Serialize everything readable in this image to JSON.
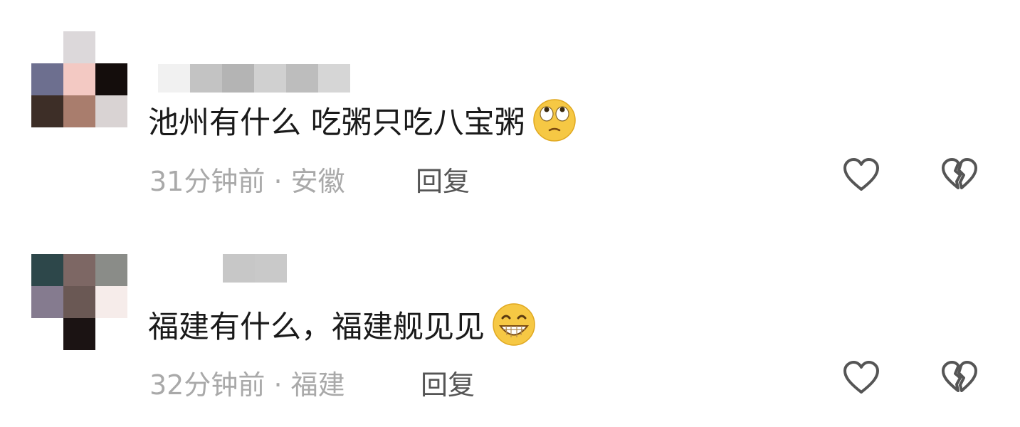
{
  "comments": [
    {
      "text": "池州有什么 吃粥只吃八宝粥",
      "emoji": "eye-roll-emoji",
      "time": "31分钟前",
      "separator": "·",
      "location": "安徽",
      "reply_label": "回复"
    },
    {
      "text": "福建有什么，福建舰见见",
      "emoji": "grin-emoji",
      "time": "32分钟前",
      "separator": "·",
      "location": "福建",
      "reply_label": "回复"
    }
  ],
  "icons": {
    "like": "heart-outline-icon",
    "dislike": "broken-heart-icon"
  },
  "colors": {
    "text": "#1a1a1a",
    "meta": "#a9a9a9",
    "reply": "#555555",
    "icon": "#555555"
  }
}
